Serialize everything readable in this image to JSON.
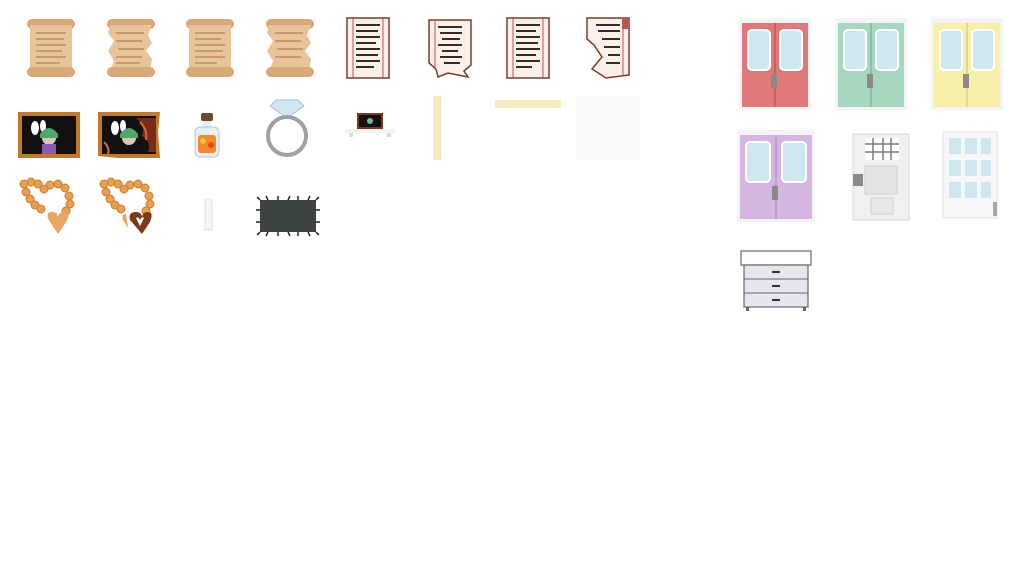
{
  "sheet": {
    "background": "#ffffff",
    "sprites": [
      {
        "name": "scroll-intact-1-icon"
      },
      {
        "name": "scroll-torn-1-icon"
      },
      {
        "name": "scroll-intact-2-icon"
      },
      {
        "name": "scroll-torn-2-icon"
      },
      {
        "name": "paper-page-intact-1-icon"
      },
      {
        "name": "paper-page-torn-1-icon"
      },
      {
        "name": "paper-page-intact-2-icon"
      },
      {
        "name": "paper-page-torn-2-icon"
      },
      {
        "name": "framed-portrait-icon"
      },
      {
        "name": "framed-portrait-burned-icon"
      },
      {
        "name": "jar-of-candies-icon"
      },
      {
        "name": "diamond-ring-icon"
      },
      {
        "name": "small-portrait-on-shelf-icon"
      },
      {
        "name": "vertical-paper-strip-icon"
      },
      {
        "name": "horizontal-paper-strip-icon"
      },
      {
        "name": "blank-white-card-icon"
      },
      {
        "name": "bead-necklace-heart-icon"
      },
      {
        "name": "bead-necklace-broken-heart-icon"
      },
      {
        "name": "small-white-paper-icon"
      },
      {
        "name": "dark-fuzzy-rug-icon"
      },
      {
        "name": "red-double-door-icon"
      },
      {
        "name": "green-double-door-icon"
      },
      {
        "name": "yellow-double-door-icon"
      },
      {
        "name": "purple-double-door-icon"
      },
      {
        "name": "white-door-with-grille-window-icon"
      },
      {
        "name": "white-door-with-glass-panes-icon"
      },
      {
        "name": "white-drawer-cabinet-icon"
      }
    ],
    "colors": {
      "parchment": "#e8c49a",
      "paper_line": "#c0504d",
      "frame_wood": "#c07a2a",
      "door_red": "#e07a7a",
      "door_green": "#a6d8bf",
      "door_yellow": "#f7f0a8",
      "door_purple": "#d4b6e0",
      "door_glass": "#cfe8ef",
      "bead_orange": "#e8a050"
    }
  }
}
